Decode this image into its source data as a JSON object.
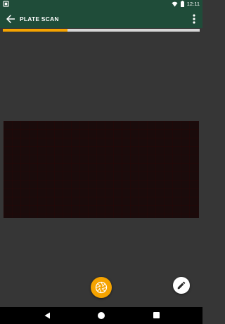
{
  "status_bar": {
    "time": "12:11",
    "icons": [
      "notification-icon",
      "wifi-icon",
      "battery-icon"
    ]
  },
  "app_bar": {
    "title": "PLATE SCAN",
    "back_icon": "arrow-back-icon",
    "menu_icon": "more-vert-icon",
    "background": "#1f4c39"
  },
  "progress": {
    "value": 0.33,
    "fill_color": "#f5a300",
    "track_color": "#d6d6d6"
  },
  "camera_preview": {
    "background": "#1a0b0b"
  },
  "actions": {
    "capture_icon": "camera-shutter-icon",
    "capture_color": "#f5a300",
    "edit_icon": "pencil-icon"
  },
  "nav_bar": {
    "buttons": [
      "back-icon",
      "home-icon",
      "recents-icon"
    ]
  }
}
